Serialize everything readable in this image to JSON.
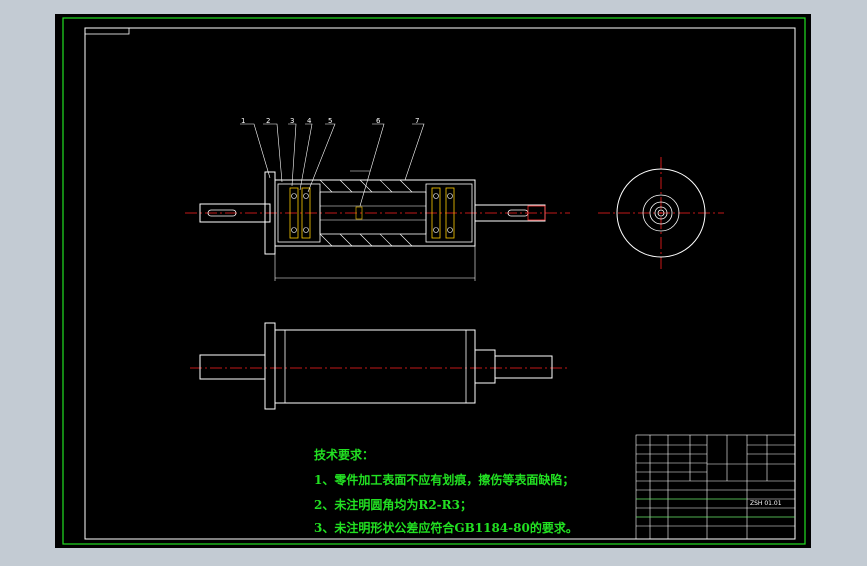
{
  "colors": {
    "background": "#c3cbd3",
    "canvas": "#000000",
    "frame": "#22e022",
    "outline": "#ffffff",
    "centerline": "#ff2020",
    "hidden_line": "#ff3030",
    "dimension": "#ffffff",
    "leader": "#ffffff"
  },
  "balloons": [
    "1",
    "2",
    "3",
    "4",
    "5",
    "6",
    "7"
  ],
  "technical_notes": {
    "title": "技术要求：",
    "lines": [
      "1、零件加工表面不应有划痕，擦伤等表面缺陷；",
      "2、未注明圆角均为R2-R3；",
      "3、未注明形状公差应符合GB1184-80的要求。"
    ]
  },
  "title_block": {
    "drawing_no": "ZSH 01.01"
  }
}
